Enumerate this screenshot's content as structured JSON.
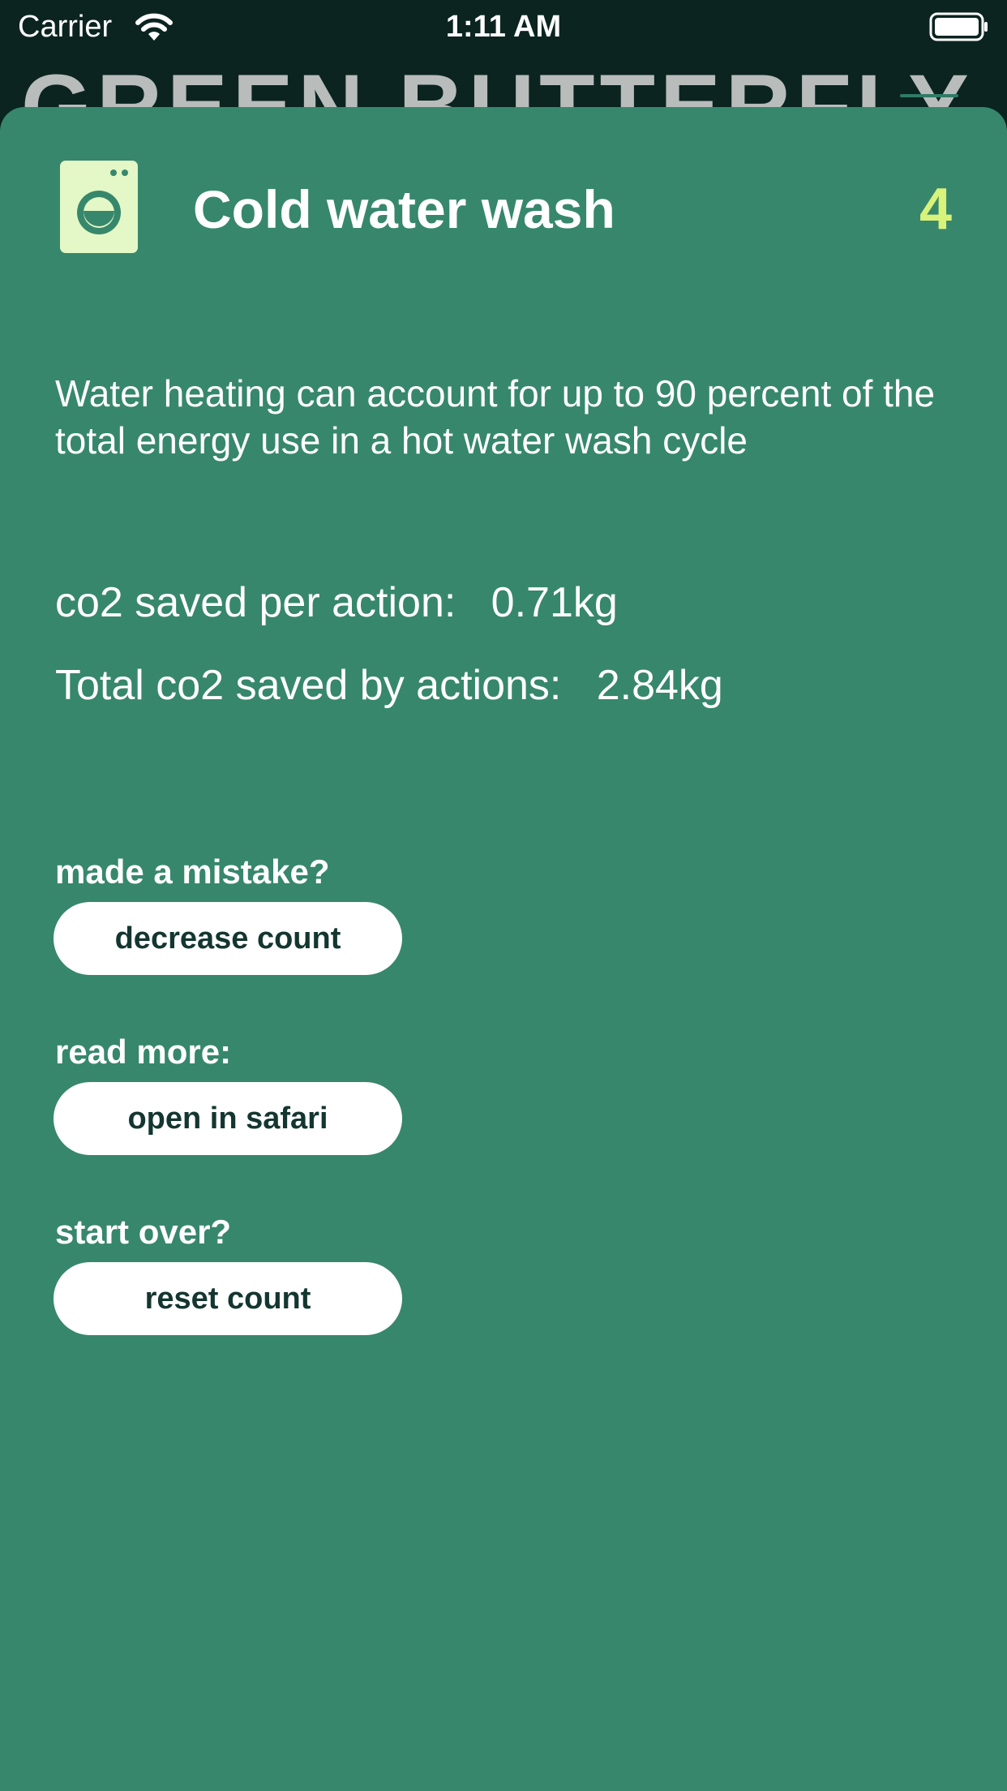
{
  "status_bar": {
    "carrier": "Carrier",
    "time": "1:11 AM",
    "icons": [
      "wifi-icon",
      "battery-icon"
    ]
  },
  "background_header": {
    "title": "GREEN BUTTERFLY",
    "menu_icon": "menu-icon"
  },
  "action": {
    "icon": "washing-machine-icon",
    "title": "Cold water wash",
    "count": "4",
    "description": "Water heating can account for up to 90 percent of the total energy use in a hot water wash cycle",
    "co2_per_action_label": "co2 saved per action:",
    "co2_per_action_value": "0.71kg",
    "co2_total_label": "Total co2 saved by actions:",
    "co2_total_value": "2.84kg"
  },
  "controls": {
    "mistake_label": "made a mistake?",
    "decrease_button": "decrease count",
    "read_more_label": "read more:",
    "safari_button": "open in safari",
    "start_over_label": "start over?",
    "reset_button": "reset count"
  },
  "colors": {
    "sheet_background": "#37876c",
    "app_background": "#0b2420",
    "count_accent": "#d8f27a",
    "washer_icon_fill": "#e4f7c6",
    "button_background": "#ffffff",
    "button_text": "#143630"
  }
}
